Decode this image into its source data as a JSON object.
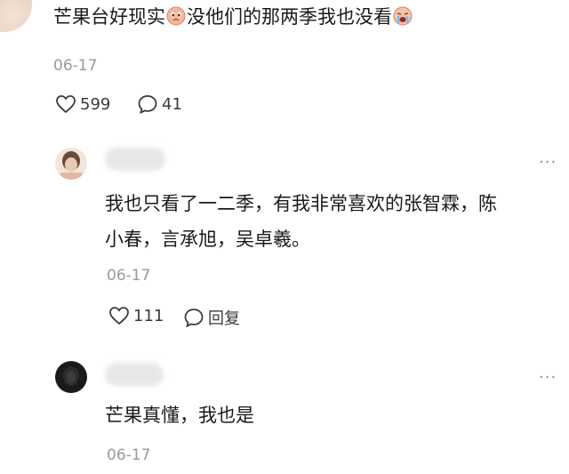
{
  "post": {
    "text_part1": "芒果台好现实",
    "text_part2": "没他们的那两季我也没看",
    "emoji1": "pleading-face-emoji",
    "emoji2": "crying-face-emoji",
    "date": "06-17",
    "likes": "599",
    "comments": "41"
  },
  "replies": [
    {
      "line1": "我也只看了一二季，有我非常喜欢的张智霖，陈",
      "line2": "小春，言承旭，吴卓羲。",
      "date": "06-17",
      "likes": "111",
      "reply_label": "回复",
      "more_label": "···"
    },
    {
      "text": "芒果真懂，我也是",
      "date": "06-17",
      "more_label": "···"
    }
  ],
  "colors": {
    "text": "#1a1a1a",
    "muted": "#9a9a9a",
    "background": "#ffffff"
  }
}
